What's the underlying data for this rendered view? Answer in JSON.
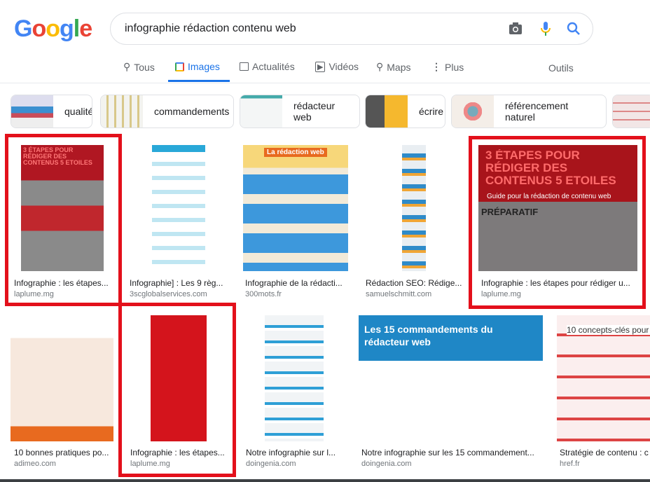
{
  "header": {
    "logo": "Google",
    "search_value": "infographie rédaction contenu web",
    "icons": [
      "camera-icon",
      "microphone-icon",
      "search-icon"
    ]
  },
  "tabs": [
    {
      "label": "Tous",
      "icon": "search-icon"
    },
    {
      "label": "Images",
      "icon": "image-icon",
      "active": true
    },
    {
      "label": "Actualités",
      "icon": "news-icon"
    },
    {
      "label": "Vidéos",
      "icon": "play-icon"
    },
    {
      "label": "Maps",
      "icon": "map-pin-icon"
    },
    {
      "label": "Plus",
      "icon": "more-vert-icon"
    }
  ],
  "tools_label": "Outils",
  "chips": [
    "qualité",
    "commandements",
    "rédacteur web",
    "écrire",
    "référencement naturel"
  ],
  "results": [
    {
      "caption": "Infographie : les étapes...",
      "source": "laplume.mg",
      "highlighted": true
    },
    {
      "caption": "Infographie] : Les 9 règ...",
      "source": "3scglobalservices.com"
    },
    {
      "caption": "Infographie de la rédacti...",
      "source": "300mots.fr"
    },
    {
      "caption": "Rédaction SEO: Rédige...",
      "source": "samuelschmitt.com"
    },
    {
      "caption": "Infographie : les étapes pour rédiger u...",
      "source": "laplume.mg",
      "highlighted": true
    },
    {
      "caption": "10 bonnes pratiques po...",
      "source": "adimeo.com"
    },
    {
      "caption": "Infographie : les étapes...",
      "source": "laplume.mg",
      "highlighted": true
    },
    {
      "caption": "Notre infographie sur l...",
      "source": "doingenia.com"
    },
    {
      "caption": "Notre infographie sur les 15 commandement...",
      "source": "doingenia.com"
    },
    {
      "caption": "Stratégie de contenu : c",
      "source": "href.fr"
    }
  ],
  "image_texts": {
    "laplume_title": "3 ÉTAPES POUR RÉDIGER DES CONTENUS 5 ETOILES",
    "laplume_sub": "Guide pour la rédaction de contenu web",
    "laplume_section": "PRÉPARATIF",
    "mots_title": "La rédaction web",
    "commandements_title": "Les 15 commandements du rédacteur web",
    "concepts_title": "10 concepts-clés pour"
  },
  "colors": {
    "accent": "#1a73e8",
    "highlight": "#e3101b"
  }
}
